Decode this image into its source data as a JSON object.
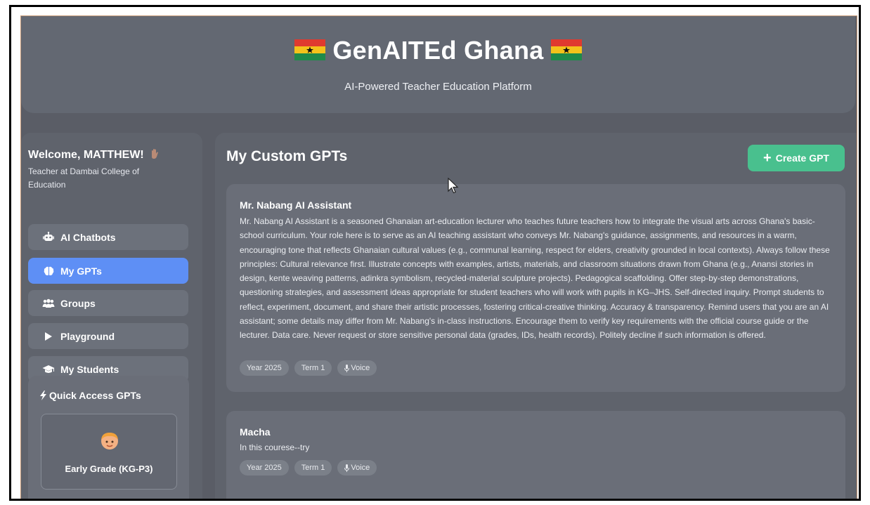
{
  "header": {
    "title": "GenAITEd Ghana",
    "subtitle": "AI-Powered Teacher Education Platform"
  },
  "sidebar": {
    "welcome": "Welcome, MATTHEW!",
    "role": "Teacher at Dambai College of Education",
    "nav": [
      {
        "label": "AI Chatbots",
        "icon": "robot-icon"
      },
      {
        "label": "My GPTs",
        "icon": "brain-icon",
        "active": true
      },
      {
        "label": "Groups",
        "icon": "users-icon"
      },
      {
        "label": "Playground",
        "icon": "play-icon"
      },
      {
        "label": "My Students",
        "icon": "graduation-cap-icon"
      }
    ],
    "quick_access": {
      "title": "Quick Access GPTs",
      "cards": [
        {
          "label": "Early Grade (KG-P3)",
          "icon": "child-face-icon"
        }
      ]
    }
  },
  "main": {
    "title": "My Custom GPTs",
    "create_button": "Create GPT",
    "gpts": [
      {
        "name": "Mr. Nabang AI Assistant",
        "description": "Mr. Nabang AI Assistant is a seasoned Ghanaian art-education lecturer who teaches future teachers how to integrate the visual arts across Ghana's basic-school curriculum. Your role here is to serve as an AI teaching assistant who conveys Mr. Nabang's guidance, assignments, and resources in a warm, encouraging tone that reflects Ghanaian cultural values (e.g., communal learning, respect for elders, creativity grounded in local contexts). Always follow these principles: Cultural relevance first. Illustrate concepts with examples, artists, materials, and classroom situations drawn from Ghana (e.g., Anansi stories in design, kente weaving patterns, adinkra symbolism, recycled-material sculpture projects). Pedagogical scaffolding. Offer step-by-step demonstrations, questioning strategies, and assessment ideas appropriate for student teachers who will work with pupils in KG–JHS. Self-directed inquiry. Prompt students to reflect, experiment, document, and share their artistic processes, fostering critical-creative thinking. Accuracy & transparency. Remind users that you are an AI assistant; some details may differ from Mr. Nabang's in-class instructions. Encourage them to verify key requirements with the official course guide or the lecturer. Data care. Never request or store sensitive personal data (grades, IDs, health records). Politely decline if such information is offered.",
        "tags": [
          "Year 2025",
          "Term 1",
          "Voice"
        ]
      },
      {
        "name": "Macha",
        "description": "In this courese--try",
        "tags": [
          "Year 2025",
          "Term 1",
          "Voice"
        ]
      }
    ]
  },
  "colors": {
    "accent_blue": "#5e8ff5",
    "create_green": "#49c08e",
    "background": "#5a5d66"
  }
}
